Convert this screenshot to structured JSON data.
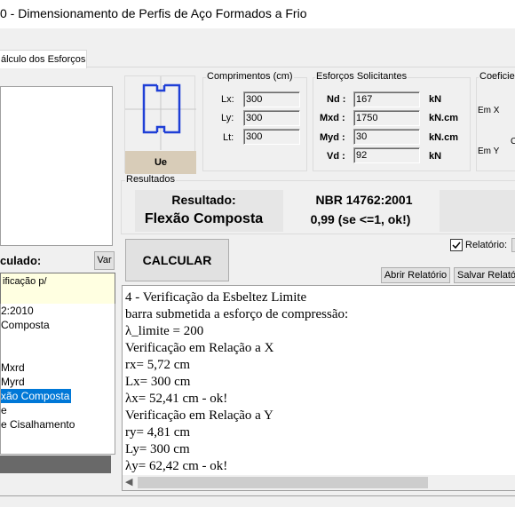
{
  "window": {
    "title": "0 - Dimensionamento de Perfis de Aço Formados a Frio"
  },
  "tabs": [
    {
      "label": "álculo dos Esforços"
    }
  ],
  "profile": {
    "label": "Ue"
  },
  "comprimentos": {
    "title": "Comprimentos (cm)",
    "lx": {
      "label": "Lx:",
      "value": "300"
    },
    "ly": {
      "label": "Ly:",
      "value": "300"
    },
    "lt": {
      "label": "Lt:",
      "value": "300"
    }
  },
  "esforcos": {
    "title": "Esforços Solicitantes",
    "nd": {
      "label": "Nd :",
      "value": "167",
      "unit": "kN"
    },
    "mxd": {
      "label": "Mxd :",
      "value": "1750",
      "unit": "kN.cm"
    },
    "myd": {
      "label": "Myd :",
      "value": "30",
      "unit": "kN.cm"
    },
    "vd": {
      "label": "Vd :",
      "value": "92",
      "unit": "kN"
    }
  },
  "coeficientes": {
    "title": "Coeficie",
    "em_x": "Em X",
    "em_y": "Em Y",
    "partial": "C"
  },
  "resultados": {
    "title": "Resultados",
    "resultado_label": "Resultado:",
    "resultado_value": "Flexão Composta",
    "norma": "NBR 14762:2001",
    "ratio": "0,99 (se <=1, ok!)"
  },
  "left": {
    "calculado_label": "culado:",
    "var_button": "Var",
    "verificacao_text": "ificação p/",
    "items": [
      {
        "text": "2:2010",
        "selected": false
      },
      {
        "text": " Composta",
        "selected": false
      },
      {
        "text": "",
        "selected": false
      },
      {
        "text": "",
        "selected": false
      },
      {
        "text": "Mxrd",
        "selected": false
      },
      {
        "text": "Myrd",
        "selected": false
      },
      {
        "text": "xão Composta",
        "selected": true
      },
      {
        "text": "e",
        "selected": false
      },
      {
        "text": " e Cisalhamento",
        "selected": false
      }
    ]
  },
  "actions": {
    "calcular": "CALCULAR",
    "relatorio_label": "Relatório:",
    "relatorio_checked": true,
    "abrir_relatorio": "Abrir Relatório",
    "salvar_relatorio": "Salvar Relató"
  },
  "report": {
    "lines": [
      "4 - Verificação da Esbeltez Limite",
      " barra submetida a esforço de compressão:",
      "λ_limite = 200",
      "Verificação em Relação a X",
      "rx= 5,72 cm",
      "Lx= 300 cm",
      "λx= 52,41 cm - ok!",
      "Verificação em Relação a Y",
      "ry= 4,81 cm",
      "Ly= 300 cm",
      "λy= 62,42 cm - ok!"
    ]
  },
  "colors": {
    "accent": "#0078d7",
    "profile_blue": "#1f3fd6",
    "window_bg": "#f0f0f0"
  }
}
